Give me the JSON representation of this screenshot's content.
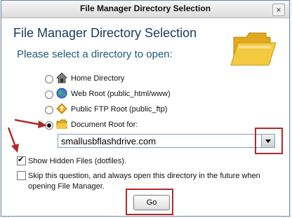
{
  "dialog": {
    "window_title": "File Manager Directory Selection",
    "close_glyph": "×",
    "heading": "File Manager Directory Selection",
    "prompt": "Please select a directory to open:"
  },
  "options": [
    {
      "label": "Home Directory",
      "icon": "home-icon",
      "selected": false
    },
    {
      "label": "Web Root (public_html/www)",
      "icon": "globe-icon",
      "selected": false
    },
    {
      "label": "Public FTP Root (public_ftp)",
      "icon": "ftp-icon",
      "selected": false
    },
    {
      "label": "Document Root for:",
      "icon": "folder-icon",
      "selected": true
    }
  ],
  "domain_select": {
    "value": "smallusbflashdrive.com"
  },
  "checkboxes": {
    "show_hidden": {
      "label": "Show Hidden Files (dotfiles).",
      "checked": true
    },
    "skip_question": {
      "label_line1": "Skip this question, and always open this directory in the future when",
      "label_line2": "opening File Manager.",
      "checked": false
    }
  },
  "go_label": "Go",
  "colors": {
    "highlight": "#b22a2a",
    "heading": "#1b3a5c",
    "prompt": "#1f5a7a",
    "folder": "#f3c93f"
  }
}
